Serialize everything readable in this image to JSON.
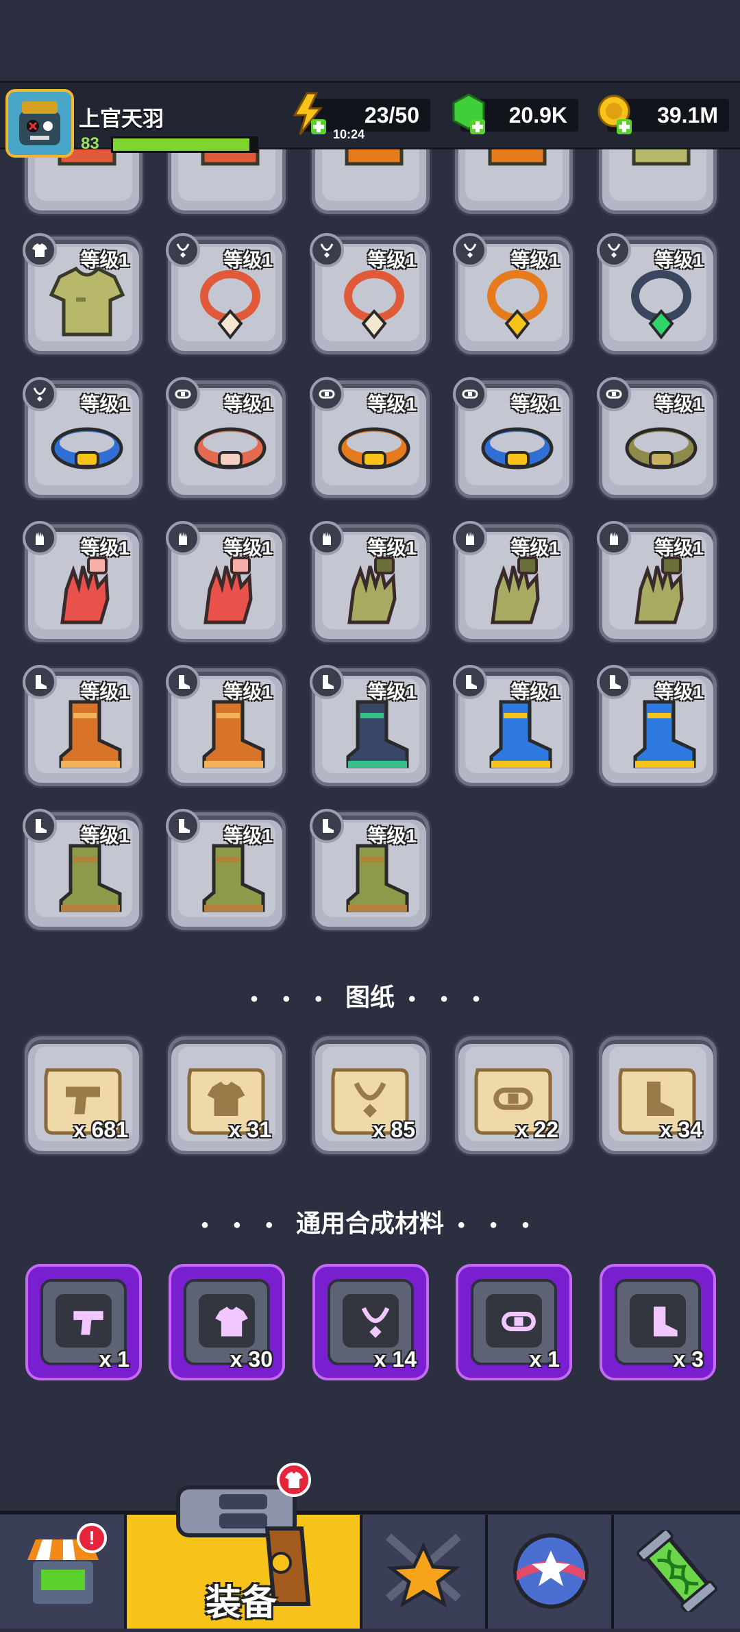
{
  "header": {
    "player_name": "上官天羽",
    "player_level": "83",
    "xp_fraction": 0.95,
    "energy": "23/50",
    "energy_timer": "10:24",
    "gems": "20.9K",
    "gold": "39.1M"
  },
  "equipment": {
    "level_label": "等级1",
    "rows": [
      [
        {
          "icon": "shirt-icon",
          "item": "camo-shirt"
        },
        {
          "icon": "necklace-icon",
          "item": "bone-necklace"
        },
        {
          "icon": "necklace-icon",
          "item": "bone-necklace"
        },
        {
          "icon": "necklace-icon",
          "item": "lightning-necklace"
        },
        {
          "icon": "necklace-icon",
          "item": "emerald-necklace"
        }
      ],
      [
        {
          "icon": "necklace-icon",
          "item": "blue-belt"
        },
        {
          "icon": "belt-icon",
          "item": "bandage-belt"
        },
        {
          "icon": "belt-icon",
          "item": "lightning-belt"
        },
        {
          "icon": "belt-icon",
          "item": "blue-orb-belt"
        },
        {
          "icon": "belt-icon",
          "item": "army-belt"
        }
      ],
      [
        {
          "icon": "glove-icon",
          "item": "red-glove"
        },
        {
          "icon": "glove-icon",
          "item": "red-glove"
        },
        {
          "icon": "glove-icon",
          "item": "camo-glove"
        },
        {
          "icon": "glove-icon",
          "item": "camo-glove"
        },
        {
          "icon": "glove-icon",
          "item": "camo-glove"
        }
      ],
      [
        {
          "icon": "boot-icon",
          "item": "brown-boot"
        },
        {
          "icon": "boot-icon",
          "item": "brown-boot"
        },
        {
          "icon": "boot-icon",
          "item": "navy-boot"
        },
        {
          "icon": "boot-icon",
          "item": "lightning-boot"
        },
        {
          "icon": "boot-icon",
          "item": "lightning-boot"
        }
      ],
      [
        {
          "icon": "boot-icon",
          "item": "camo-boot"
        },
        {
          "icon": "boot-icon",
          "item": "camo-boot"
        },
        {
          "icon": "boot-icon",
          "item": "camo-boot"
        }
      ]
    ]
  },
  "blueprints": {
    "title": "图纸",
    "dots": "• • •",
    "items": [
      {
        "icon": "gun-icon",
        "count": "x 681"
      },
      {
        "icon": "shirt-icon",
        "count": "x 31"
      },
      {
        "icon": "necklace-icon",
        "count": "x 85"
      },
      {
        "icon": "belt-icon",
        "count": "x 22"
      },
      {
        "icon": "boot-icon",
        "count": "x 34"
      }
    ]
  },
  "materials": {
    "title": "通用合成材料",
    "dots": "• • •",
    "items": [
      {
        "icon": "gun-icon",
        "count": "x 1"
      },
      {
        "icon": "shirt-icon",
        "count": "x 30"
      },
      {
        "icon": "necklace-icon",
        "count": "x 14"
      },
      {
        "icon": "belt-icon",
        "count": "x 1"
      },
      {
        "icon": "boot-icon",
        "count": "x 3"
      }
    ]
  },
  "nav": {
    "active_label": "装备",
    "shop_badge": "!",
    "items": [
      "shop-icon",
      "gun-icon",
      "star-swords-icon",
      "orb-icon",
      "dna-tube-icon"
    ]
  },
  "colors": {
    "background": "#2b2f3f",
    "tile": "#b3b6c4",
    "material_frame": "#7a1fd0",
    "active_tab": "#f7c21a",
    "xp": "#7fd42d"
  }
}
